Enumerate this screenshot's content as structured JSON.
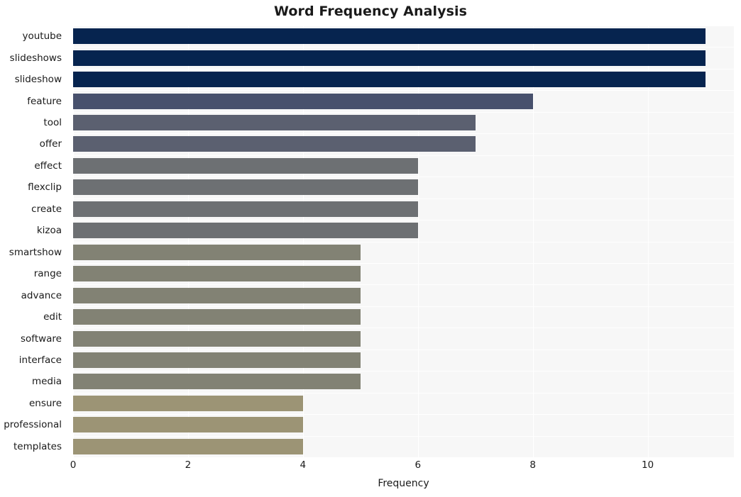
{
  "chart_data": {
    "type": "bar",
    "orientation": "horizontal",
    "title": "Word Frequency Analysis",
    "xlabel": "Frequency",
    "ylabel": "",
    "categories": [
      "youtube",
      "slideshows",
      "slideshow",
      "feature",
      "tool",
      "offer",
      "effect",
      "flexclip",
      "create",
      "kizoa",
      "smartshow",
      "range",
      "advance",
      "edit",
      "software",
      "interface",
      "media",
      "ensure",
      "professional",
      "templates"
    ],
    "values": [
      11,
      11,
      11,
      8,
      7,
      7,
      6,
      6,
      6,
      6,
      5,
      5,
      5,
      5,
      5,
      5,
      5,
      4,
      4,
      4
    ],
    "bar_colors": [
      "#06244f",
      "#06244f",
      "#06244f",
      "#48516d",
      "#5b6070",
      "#5b6070",
      "#6d7073",
      "#6d7073",
      "#6d7073",
      "#6d7073",
      "#828274",
      "#828274",
      "#828274",
      "#828274",
      "#828274",
      "#828274",
      "#828274",
      "#9c9475",
      "#9c9475",
      "#9c9475"
    ],
    "xticks": [
      0,
      2,
      4,
      6,
      8,
      10
    ],
    "xtick_labels": [
      "0",
      "2",
      "4",
      "6",
      "8",
      "10"
    ],
    "xlim": [
      0,
      11.5
    ],
    "grid": true,
    "grid_color": "#ffffff",
    "plot_background": "#f7f7f7",
    "figure_background": "#ffffff",
    "legend": null
  }
}
